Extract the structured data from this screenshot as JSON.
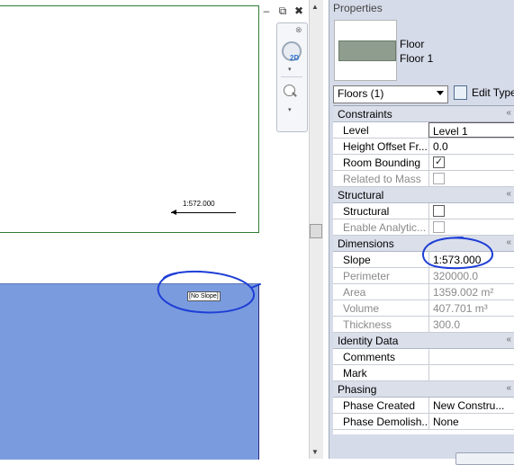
{
  "canvas": {
    "upper_slope_label": "1:572.000",
    "no_slope_tag": "[No Slope]",
    "colors": {
      "floor_fill": "#7a9cdf",
      "viewport_border": "#2e7d32",
      "markup": "#1f3fd6"
    }
  },
  "window_controls": {
    "restore_icon": "restore-icon",
    "maximize_icon": "maximize-icon",
    "close_icon": "close-icon"
  },
  "navigation_bar": {
    "wheel_label": "2D"
  },
  "properties": {
    "title": "Properties",
    "type": {
      "family": "Floor",
      "name": "Floor 1"
    },
    "filter": "Floors (1)",
    "edit_type": "Edit Type",
    "sections": {
      "constraints": "Constraints",
      "structural": "Structural",
      "dimensions": "Dimensions",
      "identity": "Identity Data",
      "phasing": "Phasing"
    },
    "rows": {
      "level": {
        "label": "Level",
        "value": "Level 1"
      },
      "height_offset": {
        "label": "Height Offset Fr...",
        "value": "0.0"
      },
      "room_bounding": {
        "label": "Room Bounding",
        "checked": true
      },
      "related_to_mass": {
        "label": "Related to Mass",
        "checked": false
      },
      "structural": {
        "label": "Structural",
        "checked": false
      },
      "enable_analytic": {
        "label": "Enable Analytic...",
        "checked": false
      },
      "slope": {
        "label": "Slope",
        "value": "1:573.000"
      },
      "perimeter": {
        "label": "Perimeter",
        "value": "320000.0"
      },
      "area": {
        "label": "Area",
        "value": "1359.002 m²"
      },
      "volume": {
        "label": "Volume",
        "value": "407.701 m³"
      },
      "thickness": {
        "label": "Thickness",
        "value": "300.0"
      },
      "comments": {
        "label": "Comments",
        "value": ""
      },
      "mark": {
        "label": "Mark",
        "value": ""
      },
      "phase_created": {
        "label": "Phase Created",
        "value": "New Constru..."
      },
      "phase_demolished": {
        "label": "Phase Demolish...",
        "value": "None"
      }
    },
    "collapse_glyph": "«"
  }
}
